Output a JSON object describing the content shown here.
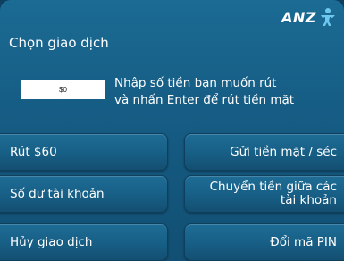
{
  "brand": {
    "name": "ANZ"
  },
  "screen": {
    "title": "Chọn giao dịch"
  },
  "amount": {
    "value": "$0"
  },
  "instructions": {
    "line1": "Nhập số tiền bạn muốn rút",
    "line2": "và nhấn Enter để rút tiền mặt"
  },
  "options": {
    "withdraw_60": "Rút $60",
    "deposit": "Gửi tiền mặt / séc",
    "balance": "Số dư tài khoản",
    "transfer_line1": "Chuyển tiền giữa các",
    "transfer_line2": "tài khoản",
    "cancel": "Hủy giao dịch",
    "change_pin": "Đổi mã PIN"
  },
  "colors": {
    "background": "#165d85",
    "button": "#175e85",
    "text": "#ffffff"
  }
}
